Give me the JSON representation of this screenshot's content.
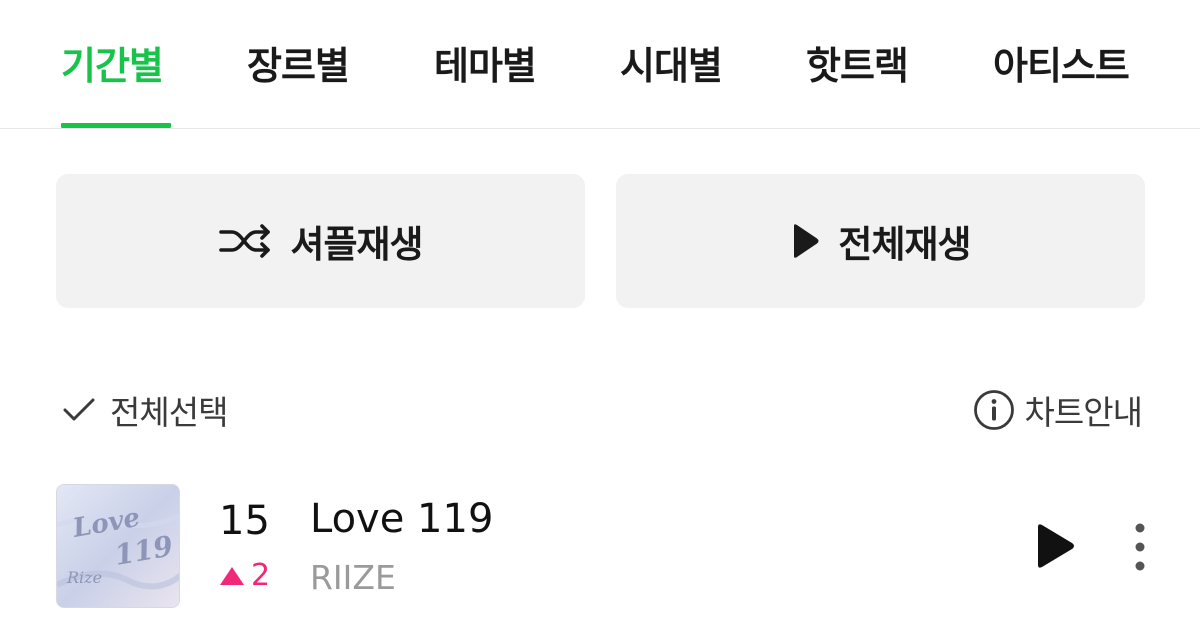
{
  "tabs": [
    {
      "label": "기간별",
      "active": true
    },
    {
      "label": "장르별",
      "active": false
    },
    {
      "label": "테마별",
      "active": false
    },
    {
      "label": "시대별",
      "active": false
    },
    {
      "label": "핫트랙",
      "active": false
    },
    {
      "label": "아티스트",
      "active": false
    }
  ],
  "actions": {
    "shuffle_label": "셔플재생",
    "play_all_label": "전체재생"
  },
  "list_controls": {
    "select_all_label": "전체선택",
    "chart_info_label": "차트안내"
  },
  "tracks": [
    {
      "rank": "15",
      "change": "2",
      "change_direction": "up",
      "title": "Love 119",
      "artist": "RIIZE"
    }
  ],
  "colors": {
    "accent": "#18c34a",
    "rank_up": "#f0287a",
    "button_bg": "#f2f2f2"
  },
  "icons": [
    "shuffle-icon",
    "play-icon",
    "check-icon",
    "info-icon",
    "more-vertical-icon",
    "triangle-up-icon"
  ]
}
